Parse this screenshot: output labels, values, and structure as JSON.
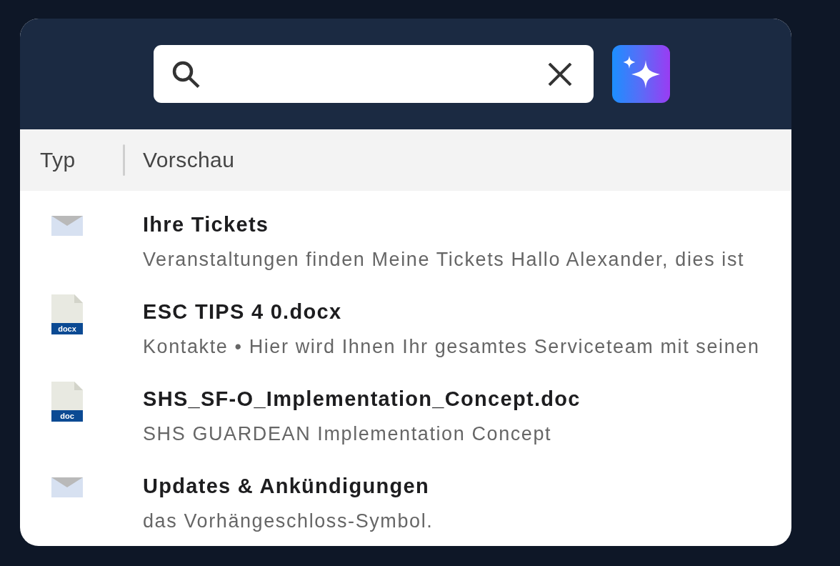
{
  "columns": [
    {
      "label": "Typ"
    },
    {
      "label": "Vorschau"
    }
  ],
  "results": [
    {
      "kind": "mail",
      "title": "Ihre Tickets",
      "preview": "Veranstaltungen finden Meine Tickets Hallo Alexander, dies ist"
    },
    {
      "kind": "file",
      "badge": "docx",
      "title": "ESC TIPS 4 0.docx",
      "preview": "Kontakte • Hier wird Ihnen Ihr gesamtes Serviceteam mit seinen"
    },
    {
      "kind": "file",
      "badge": "doc",
      "title": "SHS_SF-O_Implementation_Concept.doc",
      "preview": "SHS GUARDEAN Implementation Concept"
    },
    {
      "kind": "mail",
      "title": "Updates & Ankündigungen",
      "preview": "das Vorhängeschloss-Symbol."
    }
  ]
}
